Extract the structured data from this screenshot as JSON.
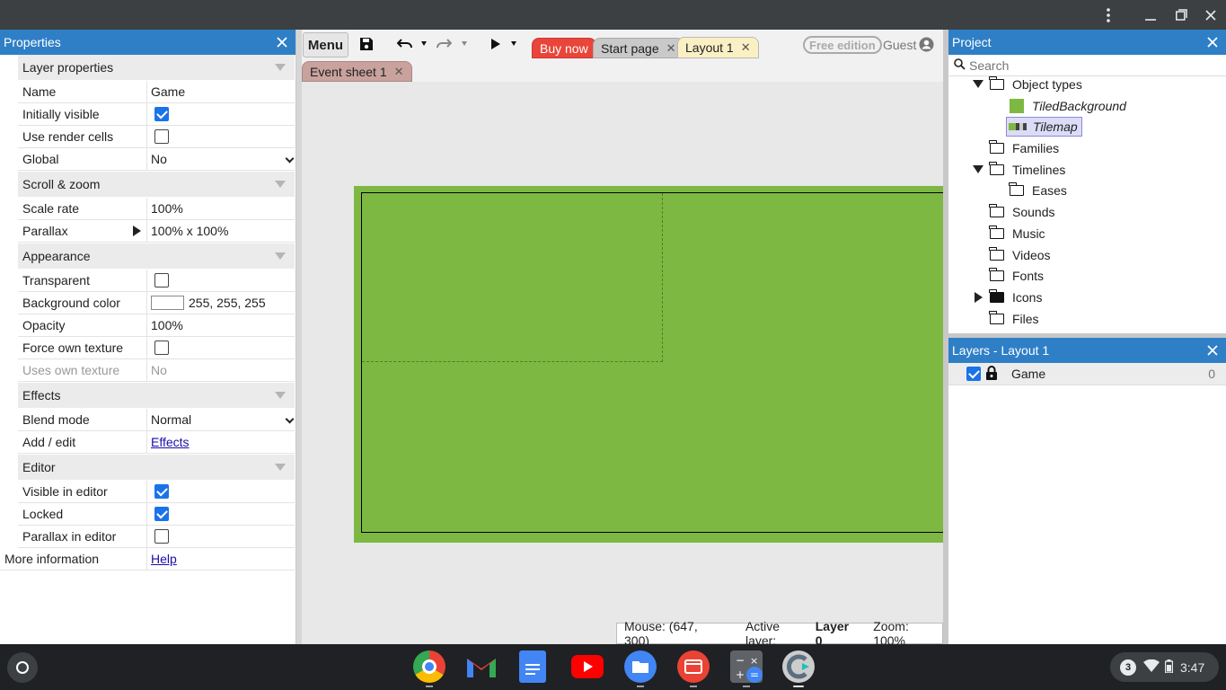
{
  "properties_panel": {
    "title": "Properties",
    "sections": {
      "layer": "Layer properties",
      "scroll": "Scroll & zoom",
      "appearance": "Appearance",
      "effects": "Effects",
      "editor": "Editor"
    },
    "rows": {
      "name": {
        "label": "Name",
        "value": "Game"
      },
      "initially_visible": {
        "label": "Initially visible",
        "checked": true
      },
      "use_render_cells": {
        "label": "Use render cells",
        "checked": false
      },
      "global": {
        "label": "Global",
        "value": "No"
      },
      "scale_rate": {
        "label": "Scale rate",
        "value": "100%"
      },
      "parallax": {
        "label": "Parallax",
        "value": "100% x 100%"
      },
      "transparent": {
        "label": "Transparent",
        "checked": false
      },
      "background_color": {
        "label": "Background color",
        "value": "255, 255, 255",
        "color": "#ffffff"
      },
      "opacity": {
        "label": "Opacity",
        "value": "100%"
      },
      "force_own_texture": {
        "label": "Force own texture",
        "checked": false
      },
      "uses_own_texture": {
        "label": "Uses own texture",
        "value": "No"
      },
      "blend_mode": {
        "label": "Blend mode",
        "value": "Normal"
      },
      "add_edit": {
        "label": "Add / edit",
        "value": "Effects"
      },
      "visible_in_editor": {
        "label": "Visible in editor",
        "checked": true
      },
      "locked": {
        "label": "Locked",
        "checked": true
      },
      "parallax_in_editor": {
        "label": "Parallax in editor",
        "checked": false
      },
      "more_info": {
        "label": "More information",
        "value": "Help"
      }
    }
  },
  "toolbar": {
    "menu": "Menu",
    "buy_now": "Buy now",
    "free_edition": "Free edition",
    "guest": "Guest",
    "tabs": [
      {
        "label": "Start page"
      },
      {
        "label": "Layout 1"
      },
      {
        "label": "Event sheet 1"
      }
    ]
  },
  "layout": {
    "layout_color": "#7db843",
    "background_color": "#e8e8e8"
  },
  "statusbar": {
    "mouse": "Mouse: (647, 300)",
    "active_layer_label": "Active layer:",
    "active_layer_value": "Layer 0",
    "zoom": "Zoom: 100%"
  },
  "project_panel": {
    "title": "Project",
    "search_placeholder": "Search",
    "items": {
      "object_types": "Object types",
      "tiled_background": "TiledBackground",
      "tilemap": "Tilemap",
      "families": "Families",
      "timelines": "Timelines",
      "eases": "Eases",
      "sounds": "Sounds",
      "music": "Music",
      "videos": "Videos",
      "fonts": "Fonts",
      "icons": "Icons",
      "files": "Files"
    }
  },
  "layers_panel": {
    "title": "Layers - Layout 1",
    "layers": [
      {
        "name": "Game",
        "index": "0",
        "visible": true,
        "locked": true
      }
    ]
  },
  "shelf": {
    "notification_count": "3",
    "time": "3:47",
    "apps": [
      "chrome-icon",
      "gmail-icon",
      "docs-icon",
      "youtube-icon",
      "files-icon",
      "screencast-icon",
      "calculator-icon",
      "construct-icon"
    ]
  }
}
